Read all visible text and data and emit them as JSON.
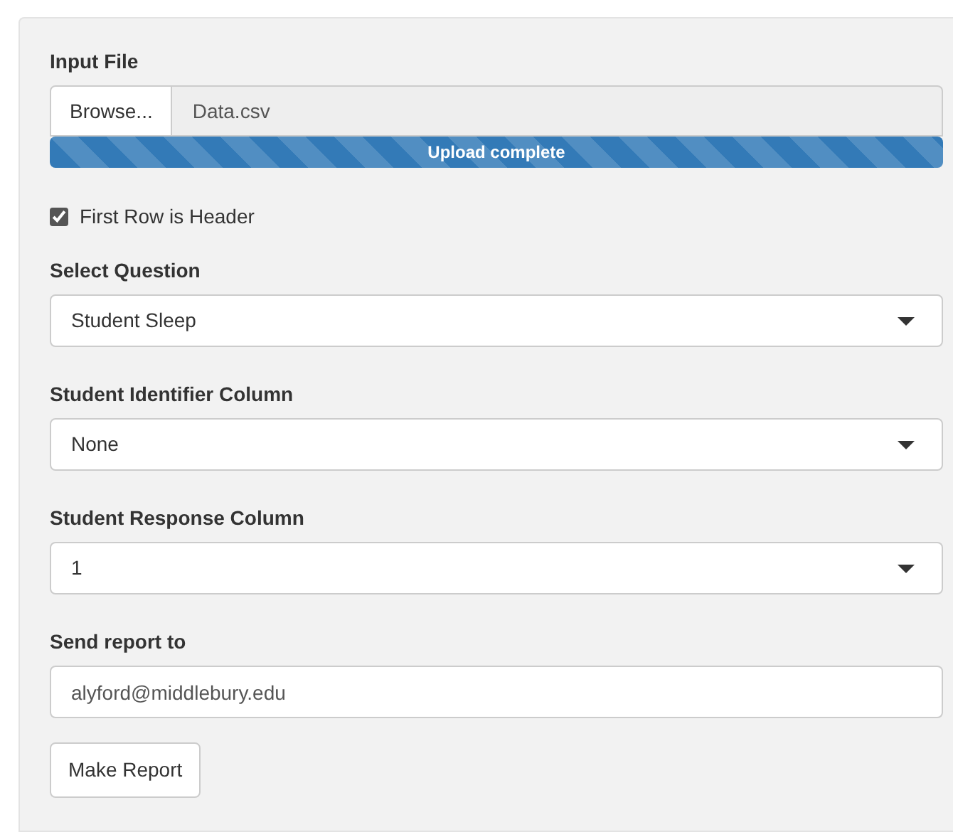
{
  "input_file": {
    "label": "Input File",
    "button": "Browse...",
    "filename": "Data.csv",
    "progress": {
      "level": 1,
      "text": "Upload complete"
    }
  },
  "header_checkbox": {
    "label": "First Row is Header",
    "checked": true
  },
  "selects": [
    {
      "label": "Select Question",
      "value": "Student Sleep"
    },
    {
      "label": "Student Identifier Column",
      "value": "None"
    },
    {
      "label": "Student Response Column",
      "value": "1"
    }
  ],
  "email": {
    "label": "Send report to",
    "value": "alyford@middlebury.edu"
  },
  "submit_button": "Make Report"
}
